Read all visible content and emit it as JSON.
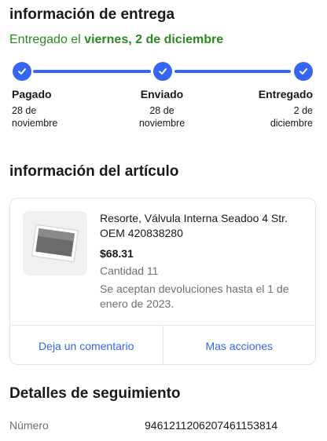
{
  "delivery": {
    "title": "información de entrega",
    "status_prefix": "Entregado el ",
    "status_date": "viernes, 2 de diciembre",
    "accent_color": "#3665f3",
    "success_color": "#2a8a1f",
    "steps": [
      {
        "label": "Pagado",
        "date": "28 de noviembre",
        "done": true
      },
      {
        "label": "Enviado",
        "date": "28 de noviembre",
        "done": true
      },
      {
        "label": "Entregado",
        "date": "2 de diciembre",
        "done": true
      }
    ]
  },
  "item": {
    "section_title": "información del artículo",
    "name": "Resorte, Válvula Interna Seadoo 4 Str. OEM 420838280",
    "price": "$68.31",
    "quantity": "Cantidad 11",
    "returns": "Se aceptan devoluciones hasta el 1 de enero de 2023.",
    "image_icon": "product-photo",
    "actions": {
      "comment": "Deja un comentario",
      "more": "Mas acciones"
    }
  },
  "tracking": {
    "title": "Detalles de seguimiento",
    "number_label": "Número",
    "number_value": "9461211206207461153814"
  }
}
